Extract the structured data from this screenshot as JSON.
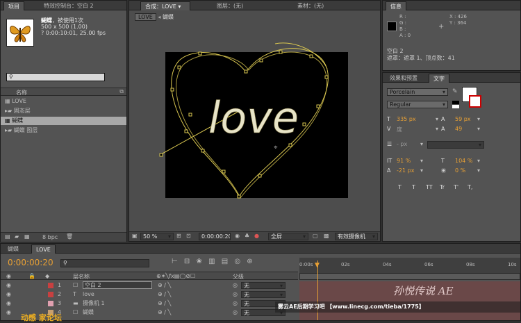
{
  "project": {
    "tab": "项目",
    "fx_tab": "特效控制台：空白 2",
    "item_name": "蝴蝶",
    "item_usage": "，被使用1次",
    "item_size": "500 x 500 (1.00)",
    "item_duration": "? 0:00:10:01, 25.00 fps",
    "search_placeholder": "",
    "col_name": "名称",
    "items": [
      {
        "label": "LOVE",
        "type": "comp"
      },
      {
        "label": "固态层",
        "type": "folder"
      },
      {
        "label": "蝴蝶",
        "type": "footage"
      },
      {
        "label": "蝴蝶 图层",
        "type": "folder"
      }
    ],
    "bpc": "8 bpc"
  },
  "viewer": {
    "tab_comp": "合成：LOVE",
    "tab_layer": "图层：(无)",
    "tab_footage": "素材：(无)",
    "crumb1": "LOVE",
    "crumb2": "蝴蝶",
    "love_text": "love",
    "zoom": "50 %",
    "timecode": "0:00:00:20",
    "quality": "全屏",
    "camera": "有效摄像机"
  },
  "info": {
    "tab": "信息",
    "r": "R :",
    "g": "G :",
    "b": "B :",
    "a": "A : 0",
    "x": "X : 426",
    "y": "Y : 364",
    "layer": "空白 2",
    "mask": "遮罩：遮罩 1、顶点数：41"
  },
  "char": {
    "tab_effects": "效果和预置",
    "tab_char": "文字",
    "font": "Porcelain",
    "style": "Regular",
    "size": "335 px",
    "leading": "59 px",
    "kerning": "度",
    "tracking": "49",
    "stroke": "- px",
    "vscale": "91 %",
    "hscale": "104 %",
    "baseline": "-21 px",
    "tsume": "0 %",
    "styles": [
      "T",
      "T",
      "TT",
      "Tr",
      "T'",
      "T,"
    ]
  },
  "timeline": {
    "tab1": "蝴蝶",
    "tab2": "LOVE",
    "time": "0:00:00:20",
    "search_placeholder": "",
    "col_name": "层名称",
    "col_parent": "父级",
    "ticks": [
      "0:00s",
      "02s",
      "04s",
      "06s",
      "08s",
      "10s"
    ],
    "layers": [
      {
        "num": "1",
        "name": "空白 2",
        "color": "#c84040",
        "parent": "无"
      },
      {
        "num": "2",
        "name": "love",
        "color": "#c84040",
        "parent": "无"
      },
      {
        "num": "3",
        "name": "摄像机 1",
        "color": "#e0a0b0",
        "parent": "无"
      },
      {
        "num": "4",
        "name": "蝴蝶",
        "color": "#c8a070",
        "parent": "无"
      }
    ]
  },
  "watermark": {
    "left": "雾云AE后期学习吧",
    "url": "【www.linecg.com/tieba/1775】",
    "brand": "孙悦传说 AE",
    "left_logo": "动感 家论坛"
  }
}
